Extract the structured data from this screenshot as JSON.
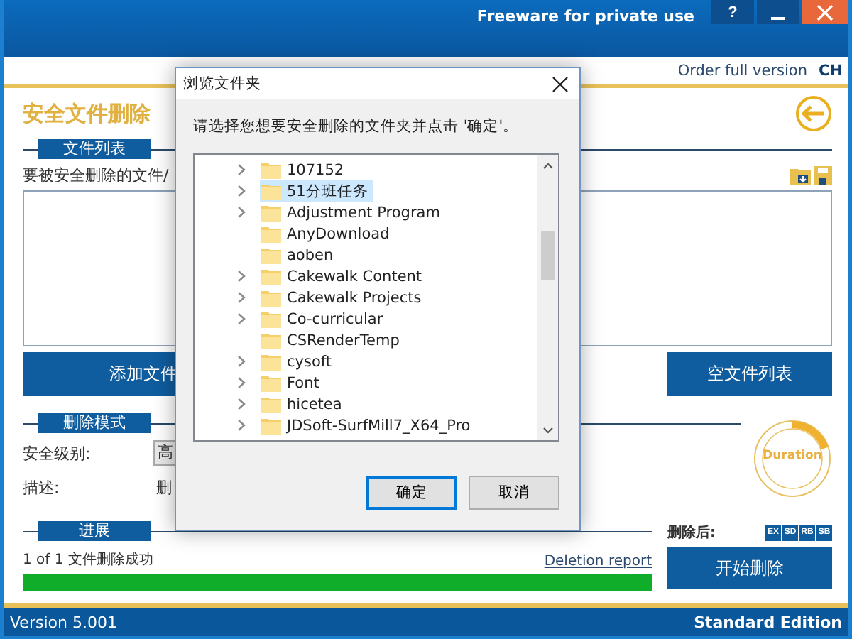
{
  "title_bar": {
    "text": "Freeware for private use",
    "help": "?"
  },
  "top_bar": {
    "order_link": "Order full version",
    "language": "CH"
  },
  "page_title": "安全文件删除",
  "file_list": {
    "header": "文件列表",
    "prompt": "要被安全删除的文件/",
    "add_button": "添加文件",
    "clear_button": "空文件列表"
  },
  "delete_mode": {
    "header": "删除模式",
    "level_label": "安全级别:",
    "level_value": "高",
    "description_label": "描述:",
    "description": "删"
  },
  "duration": {
    "label": "Duration",
    "level": 0.2
  },
  "progress": {
    "header": "进展",
    "status": "1 of 1 文件删除成功",
    "report_link": "Deletion report",
    "level": 1,
    "after_label": "删除后:",
    "after_options": [
      {
        "label": "EX"
      },
      {
        "label": "SD"
      },
      {
        "label": "RB"
      },
      {
        "label": "SB"
      }
    ],
    "start_button": "开始删除"
  },
  "status_bar": {
    "version": "Version 5.001",
    "edition": "Standard Edition"
  },
  "dialog": {
    "title": "浏览文件夹",
    "instruction": "请选择您想要安全删除的文件夹并点击 '确定'。",
    "folders": [
      {
        "name": "107152",
        "expandable": true,
        "selected": false
      },
      {
        "name": "51分班任务",
        "expandable": true,
        "selected": true
      },
      {
        "name": "Adjustment Program",
        "expandable": true,
        "selected": false
      },
      {
        "name": "AnyDownload",
        "expandable": false,
        "selected": false
      },
      {
        "name": "aoben",
        "expandable": false,
        "selected": false
      },
      {
        "name": "Cakewalk Content",
        "expandable": true,
        "selected": false
      },
      {
        "name": "Cakewalk Projects",
        "expandable": true,
        "selected": false
      },
      {
        "name": "Co-curricular",
        "expandable": true,
        "selected": false
      },
      {
        "name": "CSRenderTemp",
        "expandable": false,
        "selected": false
      },
      {
        "name": "cysoft",
        "expandable": true,
        "selected": false
      },
      {
        "name": "Font",
        "expandable": true,
        "selected": false
      },
      {
        "name": "hicetea",
        "expandable": true,
        "selected": false
      },
      {
        "name": "JDSoft-SurfMill7_X64_Pro",
        "expandable": true,
        "selected": false
      }
    ],
    "buttons": [
      {
        "label": "确定",
        "default": true
      },
      {
        "label": "取消",
        "default": false
      }
    ]
  }
}
